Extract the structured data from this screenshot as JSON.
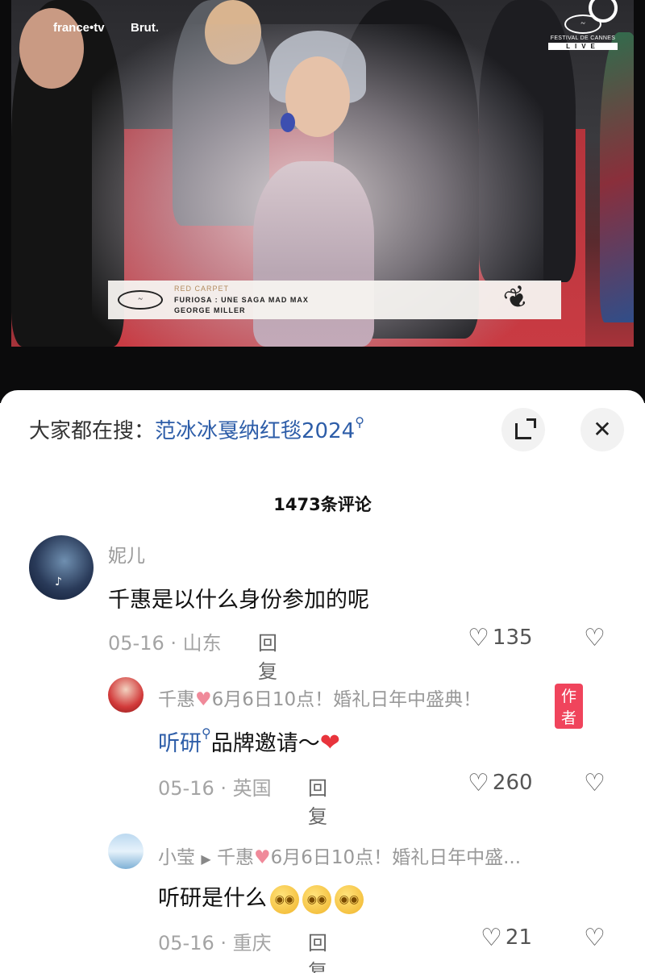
{
  "video": {
    "brand_left": "france•tv",
    "brand_right": "Brut.",
    "festival_text": "FESTIVAL DE CANNES",
    "live_label": "LIVE",
    "lower_third": {
      "line1": "RED CARPET",
      "line2": "FURIOSA : UNE SAGA MAD MAX",
      "line3": "GEORGE MILLER"
    }
  },
  "search_bar": {
    "prefix": "大家都在搜：",
    "term": "范冰冰戛纳红毯2024",
    "icon": "search-icon"
  },
  "buttons": {
    "expand_icon": "expand-icon",
    "close_glyph": "✕"
  },
  "comments_count": "1473条评论",
  "comments": [
    {
      "author": "妮儿",
      "text": "千惠是以什么身份参加的呢",
      "date_location": "05-16 · 山东",
      "reply_label": "回复",
      "likes": "135"
    }
  ],
  "replies": [
    {
      "author": "千惠",
      "author_suffix": "6月6日10点！婚礼日年中盛典！",
      "badge": "作者",
      "mention": "听研",
      "text": "品牌邀请～",
      "date_location": "05-16 · 英国",
      "reply_label": "回复",
      "likes": "260"
    },
    {
      "author": "小莹",
      "reply_to": "千惠",
      "reply_to_suffix": "6月6日10点！婚礼日年中盛...",
      "text": "听研是什么",
      "date_location": "05-16 · 重庆",
      "reply_label": "回复",
      "likes": "21"
    }
  ],
  "colors": {
    "link_blue": "#2d5da8",
    "author_badge": "#f0445c",
    "panel_bg": "#ffffff",
    "video_bg": "#0b0b0c"
  }
}
